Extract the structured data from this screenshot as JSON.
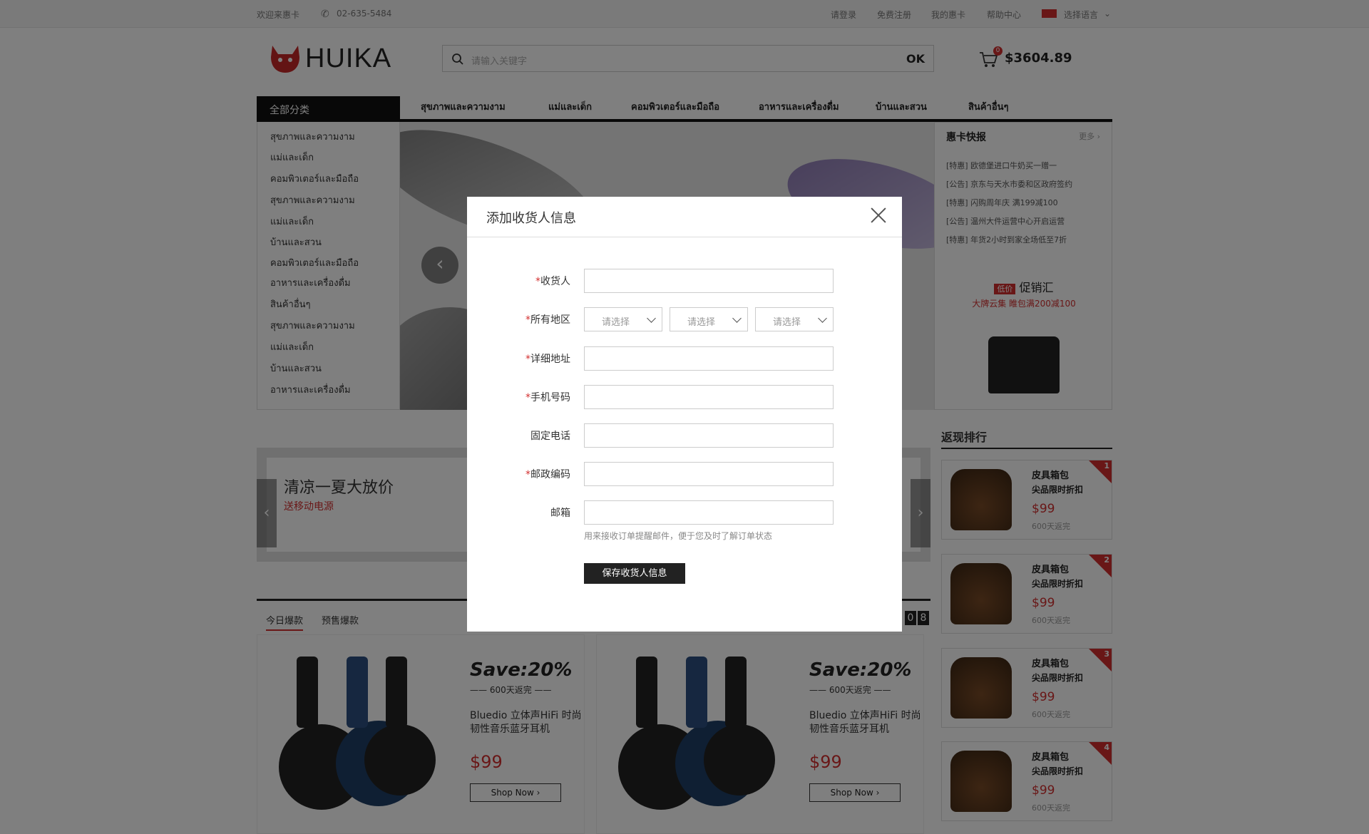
{
  "topbar": {
    "welcome": "欢迎来惠卡",
    "phone": "02-635-5484",
    "login": "请登录",
    "register": "免费注册",
    "my": "我的惠卡",
    "help": "帮助中心",
    "language": "选择语言"
  },
  "header": {
    "logo": "HUIKA",
    "search_placeholder": "请输入关键字",
    "search_button": "OK",
    "cart_count": "0",
    "cart_amount": "$3604.89"
  },
  "nav": {
    "all": "全部分类",
    "items": [
      "สุขภาพและความงาม",
      "แม่และเด็ก",
      "คอมพิวเตอร์และมือถือ",
      "อาหารและเครื่องดื่ม",
      "บ้านและสวน",
      "สินค้าอื่นๆ"
    ]
  },
  "categories": [
    "สุขภาพและความงาม",
    "แม่และเด็ก",
    "คอมพิวเตอร์และมือถือ",
    "สุขภาพและความงาม",
    "แม่และเด็ก",
    "บ้านและสวน",
    "คอมพิวเตอร์และมือถือ",
    "อาหารและเครื่องดื่ม",
    "สินค้าอื่นๆ",
    "สุขภาพและความงาม",
    "แม่และเด็ก",
    "บ้านและสวน",
    "อาหารและเครื่องดื่ม"
  ],
  "news": {
    "title": "惠卡快报",
    "more": "更多 ›",
    "items": [
      "[特惠] 欧德堡进口牛奶买一赠一",
      "[公告] 京东与天水市委和区政府签约",
      "[特惠] 闪购周年庆 满199减100",
      "[公告] 温州大件运营中心开启运营",
      "[特惠] 年货2小时到家全场低至7折"
    ],
    "promo_tag": "低价",
    "promo_title": "促销汇",
    "promo_sub": "大牌云集 睢包满200减100"
  },
  "strip": {
    "title": "清凉一夏大放价",
    "subtitle": "送移动电源"
  },
  "rank": {
    "title": "返现排行",
    "items": [
      {
        "no": "1",
        "name": "皮具箱包",
        "desc": "尖品限时折扣",
        "price": "$99",
        "sub": "600天返完"
      },
      {
        "no": "2",
        "name": "皮具箱包",
        "desc": "尖品限时折扣",
        "price": "$99",
        "sub": "600天返完"
      },
      {
        "no": "3",
        "name": "皮具箱包",
        "desc": "尖品限时折扣",
        "price": "$99",
        "sub": "600天返完"
      },
      {
        "no": "4",
        "name": "皮具箱包",
        "desc": "尖品限时折扣",
        "price": "$99",
        "sub": "600天返完"
      }
    ]
  },
  "tabs": {
    "today": "今日爆款",
    "presale": "预售爆款",
    "timer": [
      "0",
      "8"
    ]
  },
  "products": [
    {
      "save": "Save:20%",
      "days": "—— 600天返完 ——",
      "name": "Bluedio 立体声HiFi 时尚韧性音乐蓝牙耳机",
      "price": "$99",
      "button": "Shop  Now   ›"
    },
    {
      "save": "Save:20%",
      "days": "—— 600天返完 ——",
      "name": "Bluedio 立体声HiFi 时尚韧性音乐蓝牙耳机",
      "price": "$99",
      "button": "Shop  Now   ›"
    }
  ],
  "modal": {
    "title": "添加收货人信息",
    "required_mark": "*",
    "labels": {
      "receiver": "收货人",
      "region": "所有地区",
      "address": "详细地址",
      "mobile": "手机号码",
      "phone": "固定电话",
      "postcode": "邮政编码",
      "email": "邮箱"
    },
    "select_placeholder": "请选择",
    "email_hint": "用来接收订单提醒邮件，便于您及时了解订单状态",
    "save": "保存收货人信息"
  }
}
